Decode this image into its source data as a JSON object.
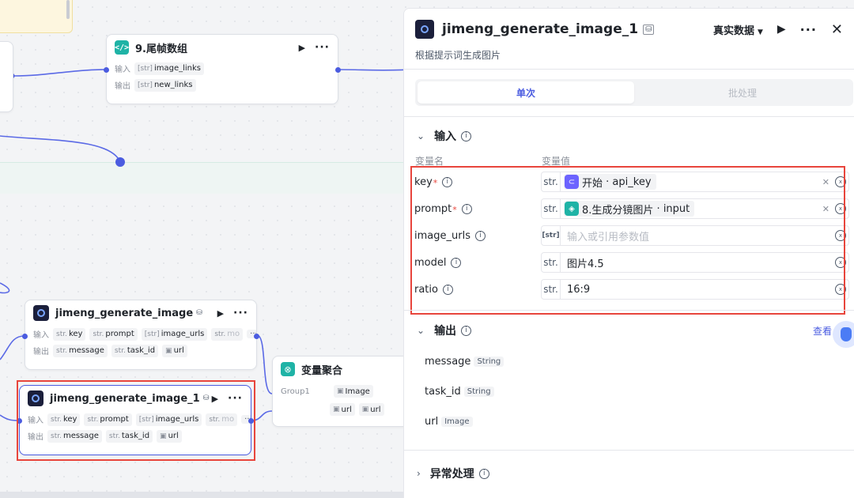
{
  "canvas": {
    "node_tail": {
      "title": "9.尾帧数组",
      "input_label": "输入",
      "output_label": "输出",
      "input_chip": {
        "type": "[str]",
        "name": "image_links"
      },
      "output_chip": {
        "type": "[str]",
        "name": "new_links"
      }
    },
    "node_gen": {
      "title": "jimeng_generate_image",
      "input_label": "输入",
      "output_label": "输出",
      "inputs": [
        {
          "type": "str.",
          "name": "key"
        },
        {
          "type": "str.",
          "name": "prompt"
        },
        {
          "type": "[str]",
          "name": "image_urls"
        },
        {
          "type": "str.",
          "name": "mo"
        }
      ],
      "outputs": [
        {
          "type": "str.",
          "name": "message"
        },
        {
          "type": "str.",
          "name": "task_id"
        },
        {
          "type": "img",
          "name": "url"
        }
      ],
      "more": "···"
    },
    "node_gen1": {
      "title": "jimeng_generate_image_1",
      "input_label": "输入",
      "output_label": "输出",
      "inputs": [
        {
          "type": "str.",
          "name": "key"
        },
        {
          "type": "str.",
          "name": "prompt"
        },
        {
          "type": "[str]",
          "name": "image_urls"
        },
        {
          "type": "str.",
          "name": "mo"
        }
      ],
      "outputs": [
        {
          "type": "str.",
          "name": "message"
        },
        {
          "type": "str.",
          "name": "task_id"
        },
        {
          "type": "img",
          "name": "url"
        }
      ],
      "more": "···"
    },
    "node_agg": {
      "title": "变量聚合",
      "group": "Group1",
      "chips": [
        "Image",
        "url",
        "url"
      ]
    }
  },
  "panel": {
    "title": "jimeng_generate_image_1",
    "subtitle": "根据提示词生成图片",
    "data_mode": "真实数据",
    "tabs": [
      "单次",
      "批处理"
    ],
    "input_section": "输入",
    "col_name": "变量名",
    "col_value": "变量值",
    "params": [
      {
        "name": "key",
        "required": true,
        "type": "str.",
        "ref_icon": "start",
        "ref_node": "开始",
        "ref_var": "api_key"
      },
      {
        "name": "prompt",
        "required": true,
        "type": "str.",
        "ref_icon": "image-node",
        "ref_node": "8.生成分镜图片",
        "ref_var": "input"
      },
      {
        "name": "image_urls",
        "required": false,
        "type": "[str]",
        "placeholder": "输入或引用参数值"
      },
      {
        "name": "model",
        "required": false,
        "type": "str.",
        "value": "图片4.5"
      },
      {
        "name": "ratio",
        "required": false,
        "type": "str.",
        "value": "16:9"
      }
    ],
    "output_section": "输出",
    "view_link": "查看",
    "outputs": [
      {
        "name": "message",
        "type": "String"
      },
      {
        "name": "task_id",
        "type": "String"
      },
      {
        "name": "url",
        "type": "Image"
      }
    ],
    "error_section": "异常处理"
  },
  "colors": {
    "accent": "#4b5ce0",
    "highlight": "#e8453c",
    "teal": "#1fb3a6"
  }
}
